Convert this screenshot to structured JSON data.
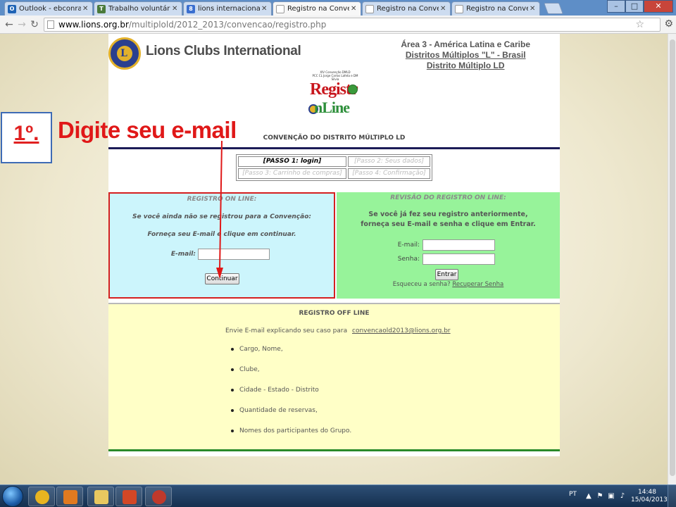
{
  "browser": {
    "tabs": [
      {
        "label": "Outlook - ebconradi@hot",
        "icon_color": "#1e63b5",
        "icon_glyph": "O"
      },
      {
        "label": "Trabalho voluntário de se",
        "icon_color": "#4a7a3a",
        "icon_glyph": "T"
      },
      {
        "label": "lions internacional - Pesq",
        "icon_color": "#3a6fd0",
        "icon_glyph": "8"
      },
      {
        "label": "Registro na Convenção DI",
        "icon_color": "#ffffff",
        "icon_glyph": ""
      },
      {
        "label": "Registro na Convenção DI",
        "icon_color": "#ffffff",
        "icon_glyph": ""
      },
      {
        "label": "Registro na Convenção DI",
        "icon_color": "#ffffff",
        "icon_glyph": ""
      }
    ],
    "url_domain": "www.lions.org.br",
    "url_path": "/multiplold/2012_2013/convencao/registro.php",
    "icons": {
      "back": "back-arrow-icon",
      "forward": "forward-arrow-icon",
      "reload": "reload-icon",
      "star": "bookmark-star-icon",
      "wrench": "wrench-menu-icon"
    }
  },
  "header": {
    "org_name": "Lions Clubs International",
    "region_line": "Área 3 - América Latina e Caribe",
    "district_multi": "Distritos Múltiplos \"L\" - Brasil",
    "district": "Distrito Múltiplo LD",
    "logo_caption_1": "XIV Convenção DMLD",
    "logo_caption_2": "PCC CL Jorge Carlos Lafeta e DM Silvia",
    "logo_word_1": "Registr",
    "logo_word_2": "nLine",
    "convention_title": "CONVENÇÃO DO DISTRITO MÚLTIPLO LD"
  },
  "steps": {
    "step1": "[PASSO 1: login]",
    "step2": "[Passo 2: Seus dados]",
    "step3": "[Passo 3: Carrinho de compras]",
    "step4": "[Passo 4: Confirmação]"
  },
  "register_panel": {
    "title": "REGISTRO ON LINE:",
    "line1": "Se você ainda não se registrou para a Convenção:",
    "line2": "Forneça seu E-mail e clique em continuar.",
    "email_label": "E-mail:",
    "email_value": "",
    "continue_label": "Continuar"
  },
  "review_panel": {
    "title": "REVISÃO DO REGISTRO ON LINE:",
    "line1": "Se você já fez seu registro anteriormente,",
    "line2": "forneça seu E-mail e senha e clique em Entrar.",
    "email_label": "E-mail:",
    "password_label": "Senha:",
    "email_value": "",
    "password_value": "",
    "enter_label": "Entrar",
    "forgot_text": "Esqueceu a senha?",
    "recover_link": "Recuperar Senha"
  },
  "offline": {
    "title": "REGISTRO OFF LINE",
    "intro": "Envie E-mail explicando seu caso para",
    "email": "convencaold2013@lions.org.br",
    "items": [
      "Cargo, Nome,",
      "Clube,",
      "Cidade - Estado - Distrito",
      "Quantidade de reservas,",
      "Nomes dos participantes do Grupo."
    ]
  },
  "annotation": {
    "step_number": "1º.",
    "instruction": "Digite seu e-mail",
    "color": "#e01818"
  },
  "taskbar": {
    "apps": [
      {
        "name": "chrome",
        "color": "#e8b420"
      },
      {
        "name": "media-player",
        "color": "#e07a20"
      },
      {
        "name": "explorer",
        "color": "#e8c860"
      },
      {
        "name": "powerpoint",
        "color": "#d24726"
      },
      {
        "name": "app",
        "color": "#c0392b"
      }
    ],
    "language": "PT",
    "time": "14:48",
    "date": "15/04/2013"
  },
  "colors": {
    "register_bg": "#ccf5fc",
    "review_bg": "#97f39a",
    "offline_bg": "#ffffc7",
    "highlight_border": "#d42020"
  }
}
